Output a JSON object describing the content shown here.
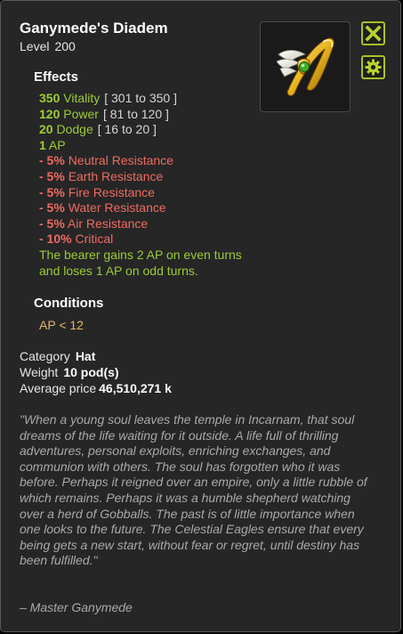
{
  "item": {
    "name": "Ganymede's Diadem",
    "level_label": "Level",
    "level_value": "200",
    "image_icon": "golden-winged-diadem-icon"
  },
  "buttons": {
    "close_icon": "close-x-icon",
    "settings_icon": "gear-icon",
    "accent_color": "#a6c226"
  },
  "effects": {
    "title": "Effects",
    "stats": [
      {
        "value": "350",
        "name": "Vitality",
        "range": "[ 301 to 350 ]"
      },
      {
        "value": "120",
        "name": "Power",
        "range": "[ 81 to 120 ]"
      },
      {
        "value": "20",
        "name": "Dodge",
        "range": "[ 16 to 20 ]"
      },
      {
        "value": "1",
        "name": "AP",
        "range": ""
      }
    ],
    "maluses": [
      {
        "value": "- 5%",
        "name": "Neutral Resistance"
      },
      {
        "value": "- 5%",
        "name": "Earth Resistance"
      },
      {
        "value": "- 5%",
        "name": "Fire Resistance"
      },
      {
        "value": "- 5%",
        "name": "Water Resistance"
      },
      {
        "value": "- 5%",
        "name": "Air Resistance"
      },
      {
        "value": "- 10%",
        "name": "Critical"
      }
    ],
    "special": "The bearer gains 2 AP on even turns and loses 1 AP on odd turns."
  },
  "conditions": {
    "title": "Conditions",
    "value": "AP < 12"
  },
  "info": {
    "category_label": "Category",
    "category_value": "Hat",
    "weight_label": "Weight",
    "weight_value": "10 pod(s)",
    "price_label": "Average price",
    "price_value": "46,510,271 k"
  },
  "lore": {
    "text": "\"When a young soul leaves the temple in Incarnam, that soul dreams of the life waiting for it outside. A life full of thrilling adventures, personal exploits, enriching exchanges, and communion with others. The soul has forgotten who it was before. Perhaps it reigned over an empire, only a little rubble of which remains. Perhaps it was a humble shepherd watching over a herd of Gobballs. The past is of little importance when one looks to the future. The Celestial Eagles ensure that every being gets a new start, without fear or regret, until destiny has been fulfilled.\"",
    "author": "– Master Ganymede"
  },
  "colors": {
    "bonus": "#9ccc36",
    "malus": "#ee6b61",
    "condition": "#e2b86a",
    "lore": "#a9a9a9",
    "panel": "#262626"
  }
}
